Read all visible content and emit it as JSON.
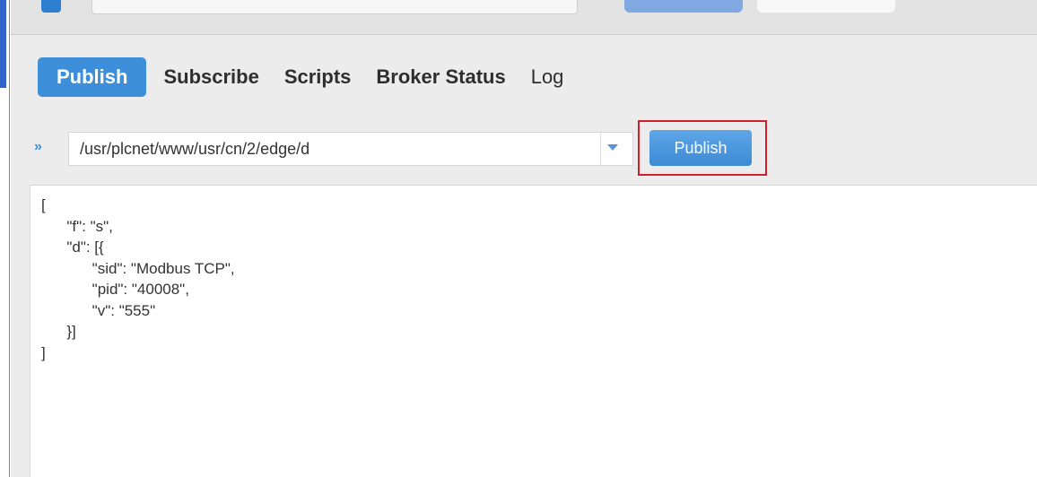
{
  "tabs": [
    {
      "label": "Publish",
      "active": true
    },
    {
      "label": "Subscribe",
      "active": false
    },
    {
      "label": "Scripts",
      "active": false
    },
    {
      "label": "Broker Status",
      "active": false
    },
    {
      "label": "Log",
      "active": false
    }
  ],
  "publish": {
    "topic_icon": "double-chevron-right-icon",
    "topic_value": "/usr/plcnet/www/usr/cn/2/edge/d",
    "dropdown_icon": "chevron-down-icon",
    "button_label": "Publish",
    "highlight_color": "#d21f2a"
  },
  "message": {
    "payload": "[\n      \"f\": \"s\",\n      \"d\": [{\n            \"sid\": \"Modbus TCP\",\n            \"pid\": \"40008\",\n            \"v\": \"555\"\n      }]\n]"
  },
  "colors": {
    "accent": "#3d8fd9",
    "highlight": "#d21f2a"
  }
}
